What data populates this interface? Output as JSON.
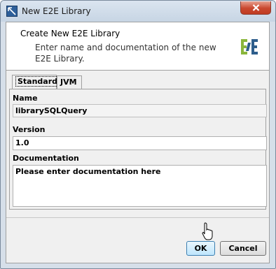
{
  "window": {
    "title": "New E2E Library"
  },
  "header": {
    "title": "Create New E2E Library",
    "description": "Enter name and documentation of the new E2E Library.",
    "logo_icon": "e2e-logo-icon"
  },
  "tabs": [
    {
      "label": "Standard",
      "active": true
    },
    {
      "label": "JVM",
      "active": false
    }
  ],
  "form": {
    "name_label": "Name",
    "name_value": "librarySQLQuery",
    "version_label": "Version",
    "version_value": "1.0",
    "documentation_label": "Documentation",
    "documentation_value": "Please enter documentation here"
  },
  "buttons": {
    "ok_label": "OK",
    "cancel_label": "Cancel"
  },
  "colors": {
    "titlebar": "#c7d5e4",
    "close_button": "#c9482f",
    "logo_green": "#8ab63c",
    "logo_blue": "#2e5e8c",
    "ok_focus": "#3c7fb1"
  }
}
